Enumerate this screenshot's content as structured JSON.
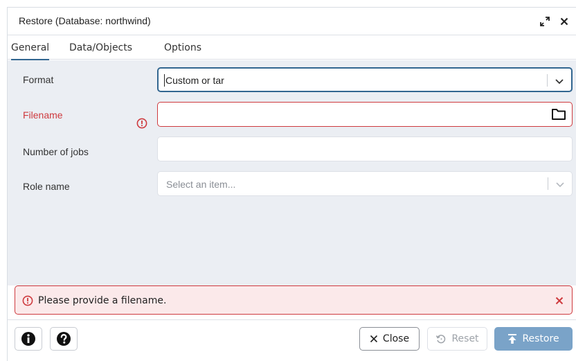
{
  "dialog": {
    "title": "Restore (Database: northwind)",
    "icons": {
      "expand": "expand-arrows-icon",
      "close": "close-x-icon"
    }
  },
  "tabs": [
    {
      "label": "General",
      "active": true
    },
    {
      "label": "Data/Objects",
      "active": false
    },
    {
      "label": "Options",
      "active": false
    }
  ],
  "form": {
    "format": {
      "label": "Format",
      "value": "Custom or tar"
    },
    "filename": {
      "label": "Filename",
      "value": "",
      "error": true
    },
    "jobs": {
      "label": "Number of jobs",
      "value": ""
    },
    "role": {
      "label": "Role name",
      "placeholder": "Select an item..."
    }
  },
  "alert": {
    "message": "Please provide a filename."
  },
  "footer": {
    "info_icon": "info-icon",
    "help_icon": "help-icon",
    "close_label": "Close",
    "reset_label": "Reset",
    "restore_label": "Restore"
  },
  "colors": {
    "accent": "#326690",
    "error": "#ce3a3e",
    "error_bg": "#fbe9ea",
    "restore_button": "#7aa3c8",
    "body_bg": "#ebeef3"
  }
}
